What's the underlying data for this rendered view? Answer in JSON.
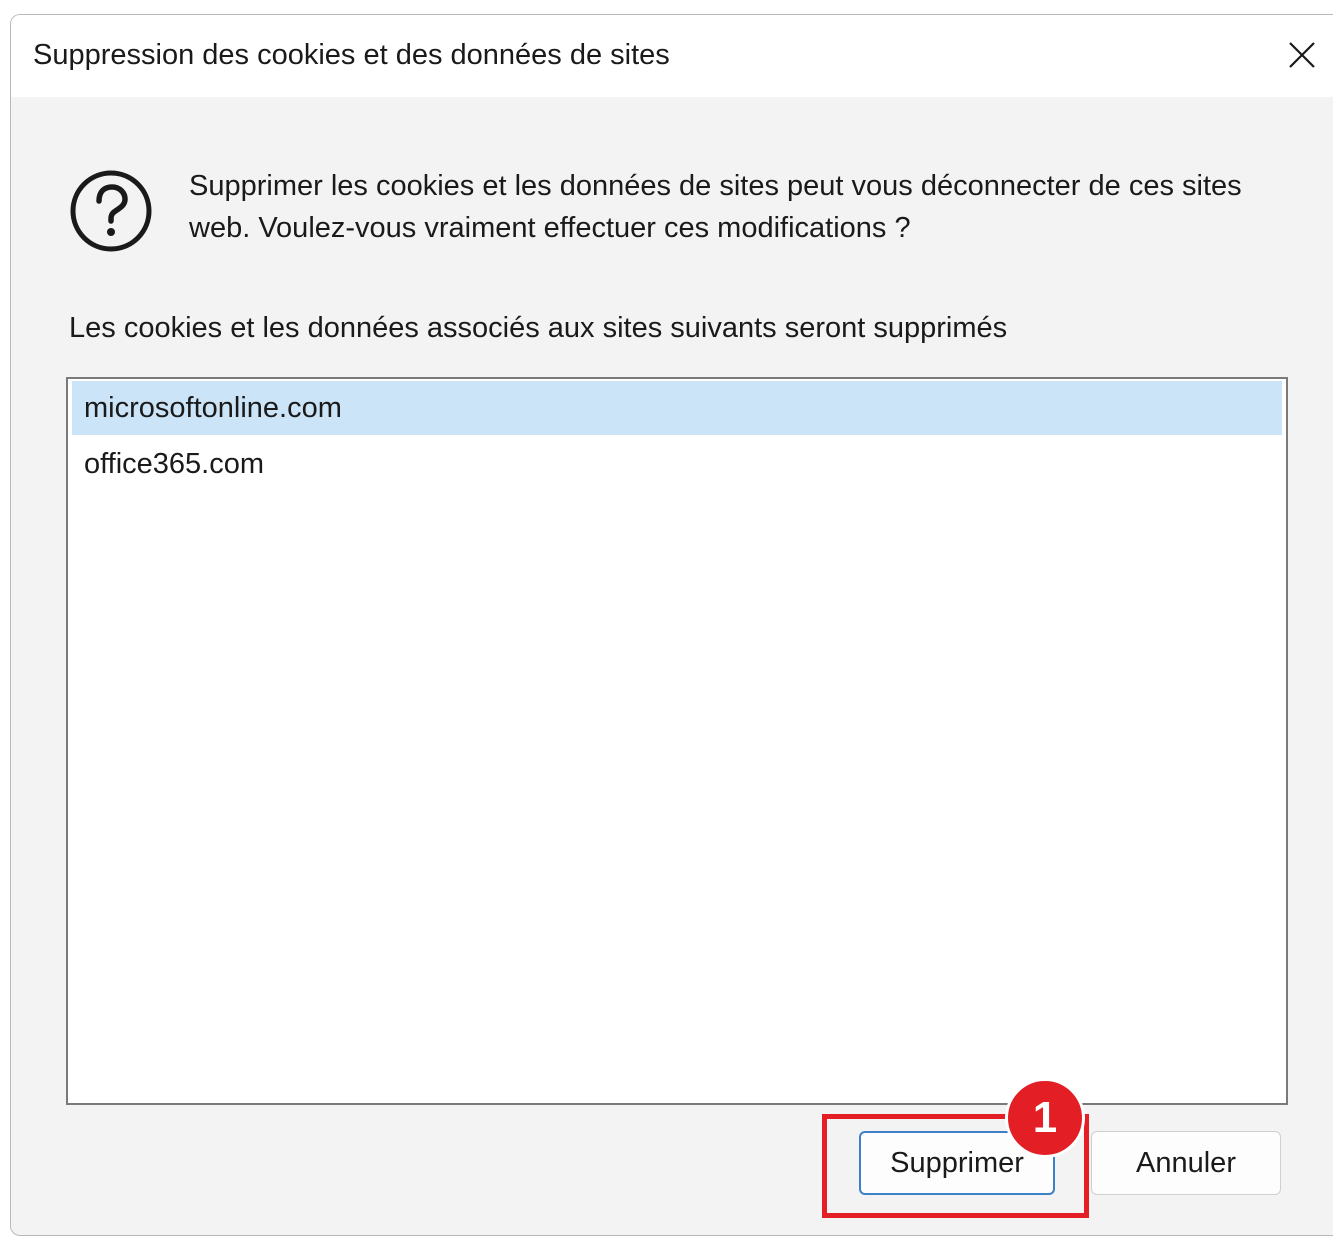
{
  "dialog": {
    "title": "Suppression des cookies et des données de sites",
    "close_icon": "close-icon",
    "message": "Supprimer les cookies et les données de sites peut vous déconnecter de ces sites web. Voulez-vous vraiment effectuer ces modifications ?",
    "message_icon": "question-icon",
    "list_caption": "Les cookies et les données associés aux sites suivants seront supprimés",
    "sites": [
      {
        "label": "microsoftonline.com",
        "selected": true
      },
      {
        "label": "office365.com",
        "selected": false
      }
    ],
    "buttons": {
      "primary_label": "Supprimer",
      "secondary_label": "Annuler"
    }
  },
  "annotation": {
    "step_number": "1",
    "color": "#e31e24"
  },
  "colors": {
    "selection": "#cce4f7",
    "primary_border": "#3d80c6"
  }
}
